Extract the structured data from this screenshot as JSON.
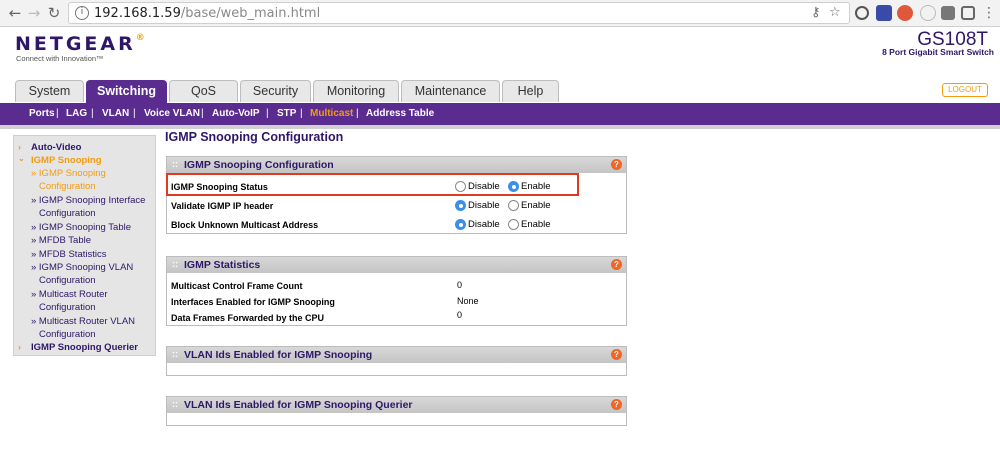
{
  "browser": {
    "url_host": "192.168.1.59",
    "url_path": "/base/web_main.html"
  },
  "header": {
    "brand": "NETGEAR",
    "brand_dot": "®",
    "tagline": "Connect with Innovation™",
    "model": "GS108T",
    "model_desc": "8 Port Gigabit Smart Switch",
    "logout_label": "LOGOUT"
  },
  "tabs": [
    "System",
    "Switching",
    "QoS",
    "Security",
    "Monitoring",
    "Maintenance",
    "Help"
  ],
  "active_tab": "Switching",
  "subnav": [
    "Ports",
    "LAG",
    "VLAN",
    "Voice VLAN",
    "Auto-VoIP",
    "STP",
    "Multicast",
    "Address Table"
  ],
  "active_subnav": "Multicast",
  "sidebar": {
    "items": [
      {
        "label": "Auto-Video"
      },
      {
        "label": "IGMP Snooping"
      },
      {
        "label": "» IGMP Snooping"
      },
      {
        "label": "Configuration"
      },
      {
        "label": "» IGMP Snooping Interface"
      },
      {
        "label": "Configuration"
      },
      {
        "label": "» IGMP Snooping Table"
      },
      {
        "label": "» MFDB Table"
      },
      {
        "label": "» MFDB Statistics"
      },
      {
        "label": "» IGMP Snooping VLAN"
      },
      {
        "label": "Configuration"
      },
      {
        "label": "» Multicast Router"
      },
      {
        "label": "Configuration"
      },
      {
        "label": "» Multicast Router VLAN"
      },
      {
        "label": "Configuration"
      },
      {
        "label": "IGMP Snooping Querier"
      }
    ]
  },
  "main": {
    "page_title": "IGMP Snooping Configuration",
    "config_panel": {
      "title": "IGMP Snooping Configuration",
      "rows": [
        {
          "label": "IGMP Snooping Status",
          "selected": "Enable"
        },
        {
          "label": "Validate IGMP IP header",
          "selected": "Disable"
        },
        {
          "label": "Block Unknown Multicast Address",
          "selected": "Disable"
        }
      ],
      "disable_label": "Disable",
      "enable_label": "Enable"
    },
    "stats_panel": {
      "title": "IGMP Statistics",
      "rows": [
        {
          "label": "Multicast Control Frame Count",
          "value": "0"
        },
        {
          "label": "Interfaces Enabled for IGMP Snooping",
          "value": "None"
        },
        {
          "label": "Data Frames Forwarded by the CPU",
          "value": "0"
        }
      ]
    },
    "vlan_panel": {
      "title": "VLAN Ids Enabled for IGMP Snooping"
    },
    "querier_panel": {
      "title": "VLAN Ids Enabled for IGMP Snooping Querier"
    }
  },
  "colors": {
    "brand_purple": "#5b2c8f",
    "accent_orange": "#f39c12",
    "highlight_red": "#e03a24",
    "radio_blue": "#3b8fe8"
  }
}
